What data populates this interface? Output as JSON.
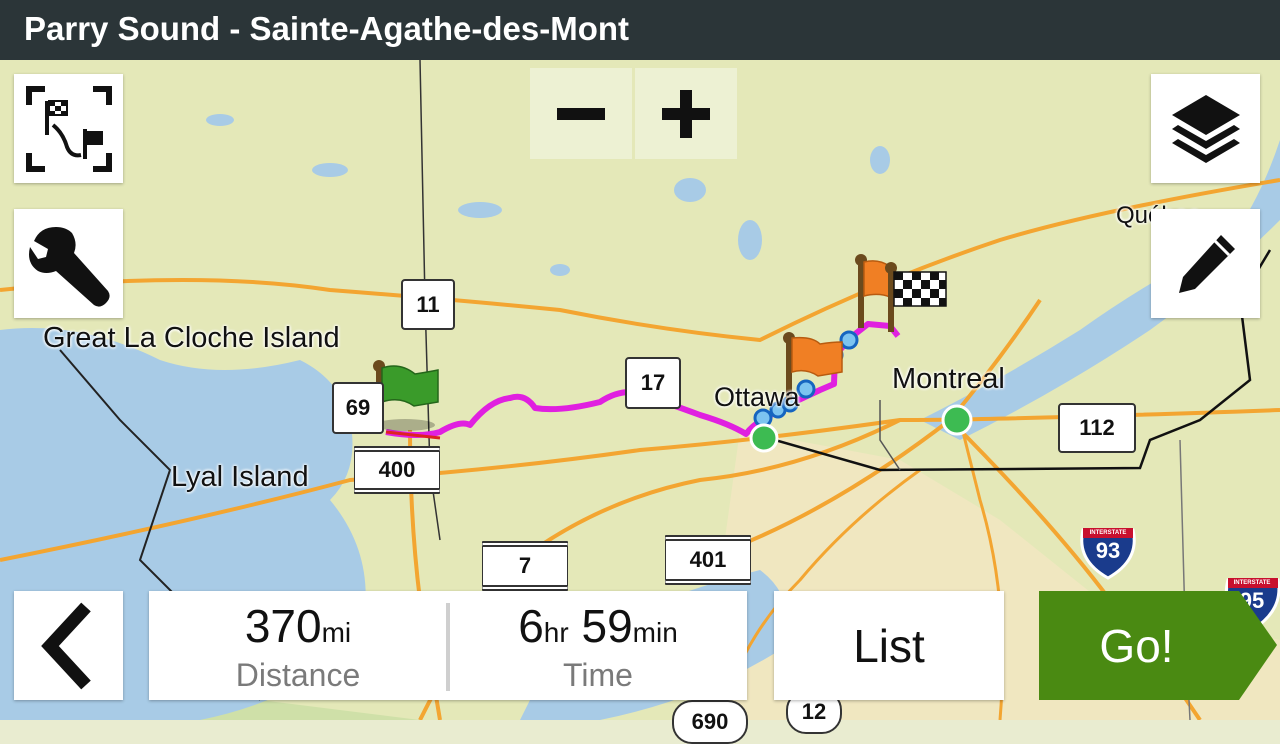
{
  "header": {
    "title": "Parry Sound - Sainte-Agathe-des-Mont"
  },
  "map": {
    "places": {
      "great_la_cloche": "Great La Cloche Island",
      "lyal": "Lyal Island",
      "ottawa": "Ottawa",
      "montreal": "Montreal",
      "quebec": "Québec"
    },
    "shields": {
      "r11": "11",
      "r69": "69",
      "r400": "400",
      "r17": "17",
      "r112": "112",
      "r7": "7",
      "r401": "401",
      "i93": "93",
      "i95": "95",
      "r690": "690",
      "r12": "12"
    },
    "interstate_label": "INTERSTATE",
    "route_color": "#e020e0",
    "water_color": "#a8cbe6",
    "land_color": "#e4e8b8"
  },
  "controls": {
    "route_overview_icon": "route-overview-icon",
    "zoom_out": "−",
    "zoom_in": "+",
    "layers_icon": "layers-icon",
    "tools_icon": "wrench-icon",
    "edit_icon": "pencil-icon",
    "back_icon": "chevron-left-icon"
  },
  "route_info": {
    "distance_value": "370",
    "distance_unit": "mi",
    "distance_label": "Distance",
    "time_hours": "6",
    "time_hours_unit": "hr",
    "time_minutes": "59",
    "time_minutes_unit": "min",
    "time_label": "Time"
  },
  "actions": {
    "list_label": "List",
    "go_label": "Go!",
    "go_color": "#4a8a12"
  }
}
